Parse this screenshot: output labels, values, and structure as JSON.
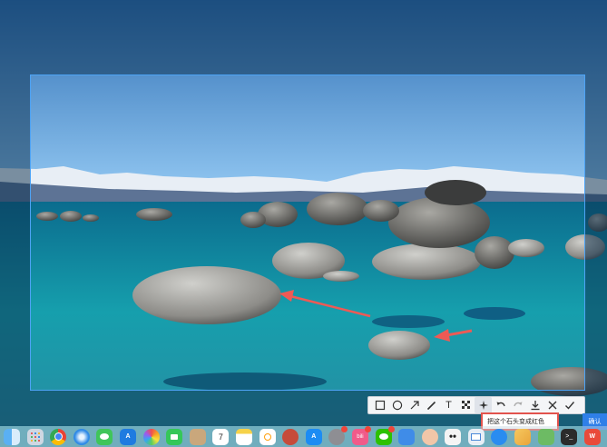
{
  "colors": {
    "selection_border": "#4da3f5",
    "annotation_arrow": "#ee5a55",
    "confirm_button": "#2f7fe8",
    "prompt_border": "#e2534d"
  },
  "toolbar": {
    "tools": [
      {
        "name": "rectangle-icon"
      },
      {
        "name": "ellipse-icon"
      },
      {
        "name": "arrow-icon"
      },
      {
        "name": "pen-icon"
      },
      {
        "name": "text-icon",
        "glyph": "T"
      },
      {
        "name": "mosaic-icon"
      },
      {
        "name": "ai-icon"
      },
      {
        "name": "undo-icon"
      },
      {
        "name": "redo-icon"
      },
      {
        "name": "download-icon"
      },
      {
        "name": "close-icon"
      },
      {
        "name": "check-icon"
      }
    ]
  },
  "prompt": {
    "text": "把这个石头变成红色"
  },
  "confirm": {
    "label": "确认"
  },
  "dock": {
    "calendar_day": "7",
    "apps": [
      "finder-icon",
      "launchpad-icon",
      "chrome-icon",
      "safari-icon",
      "messages-icon",
      "altstore-icon",
      "photos-icon",
      "facetime-icon",
      "contacts-icon",
      "calendar-icon",
      "notes-icon",
      "reminders-icon",
      "photo-booth-icon",
      "app-store-icon",
      "settings-icon",
      "bilibili-icon",
      "wechat-icon",
      "mail-app-icon",
      "avatar-app-icon",
      "panda-icon",
      "mail-icon",
      "qq-icon",
      "office-icon",
      "image-viewer-icon",
      "terminal-icon",
      "wps-icon",
      "extra-icon"
    ]
  }
}
